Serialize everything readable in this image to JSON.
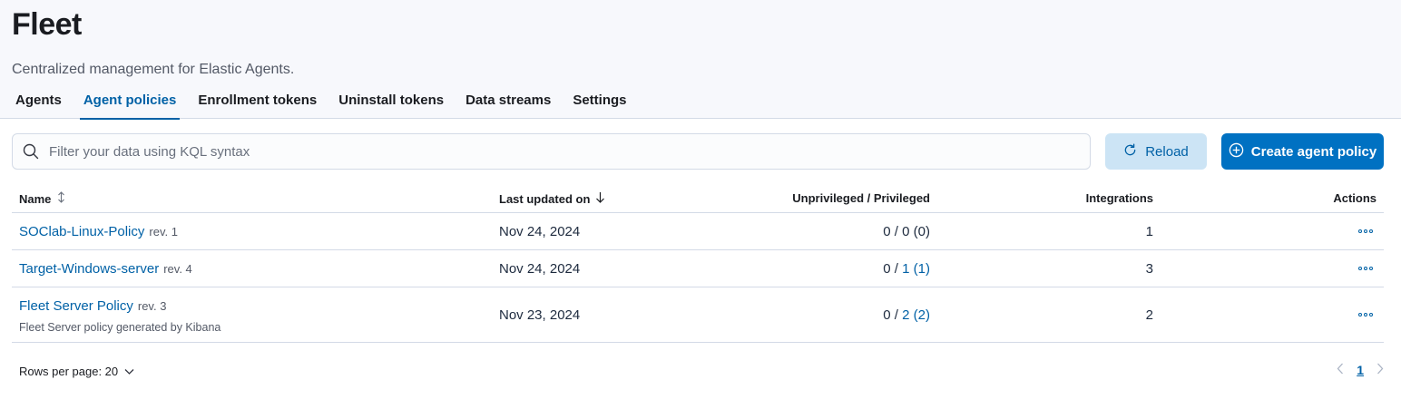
{
  "page": {
    "title": "Fleet",
    "subtitle": "Centralized management for Elastic Agents."
  },
  "tabs": [
    {
      "label": "Agents",
      "active": false
    },
    {
      "label": "Agent policies",
      "active": true
    },
    {
      "label": "Enrollment tokens",
      "active": false
    },
    {
      "label": "Uninstall tokens",
      "active": false
    },
    {
      "label": "Data streams",
      "active": false
    },
    {
      "label": "Settings",
      "active": false
    }
  ],
  "search": {
    "placeholder": "Filter your data using KQL syntax",
    "value": "",
    "icon": "search-icon"
  },
  "buttons": {
    "reload": "Reload",
    "create": "Create agent policy"
  },
  "table": {
    "columns": {
      "name": "Name",
      "updated": "Last updated on",
      "privileged": "Unprivileged / Privileged",
      "integrations": "Integrations",
      "actions": "Actions"
    },
    "rows": [
      {
        "name": "SOClab-Linux-Policy",
        "rev": "rev. 1",
        "description": "",
        "updated": "Nov 24, 2024",
        "unprivileged": "0",
        "privileged": "0",
        "total": "(0)",
        "integrations": "1"
      },
      {
        "name": "Target-Windows-server",
        "rev": "rev. 4",
        "description": "",
        "updated": "Nov 24, 2024",
        "unprivileged": "0",
        "privileged": "1",
        "total": "(1)",
        "integrations": "3"
      },
      {
        "name": "Fleet Server Policy",
        "rev": "rev. 3",
        "description": "Fleet Server policy generated by Kibana",
        "updated": "Nov 23, 2024",
        "unprivileged": "0",
        "privileged": "2",
        "total": "(2)",
        "integrations": "2"
      }
    ]
  },
  "footer": {
    "rows_per_page": "Rows per page: 20",
    "current_page": "1"
  },
  "colors": {
    "accent": "#0061a6",
    "primary_button": "#0071c2",
    "reload_bg": "#cce4f5",
    "header_bg": "#f7f8fc"
  }
}
